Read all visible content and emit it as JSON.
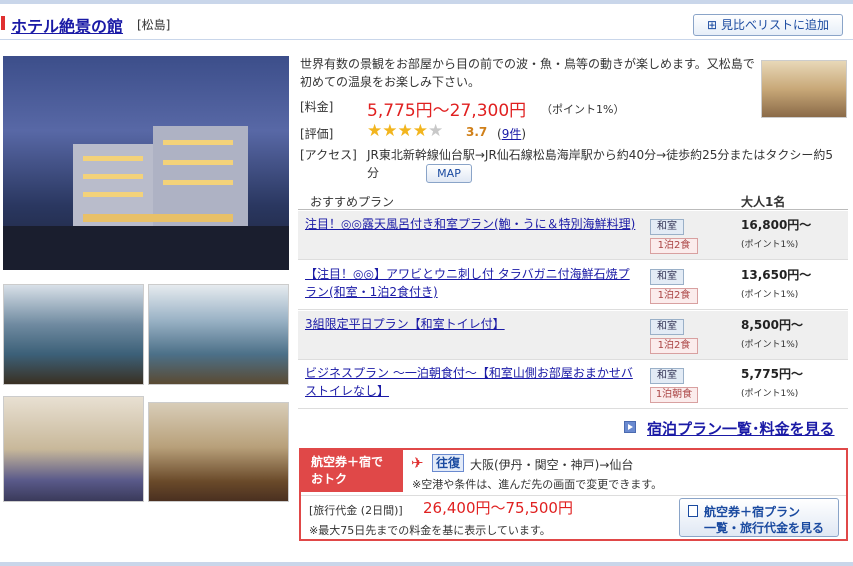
{
  "header": {
    "hotel_name": "ホテル絶景の館",
    "area": "[松島]",
    "compare_button": "見比べリストに追加"
  },
  "hotel": {
    "description": "世界有数の景観をお部屋から目の前での波・魚・鳥等の動きが楽しめます。又松島で初めての温泉をお楽しみ下さい。",
    "price_label": "[料金]",
    "price": "5,775円～27,300円",
    "price_point": "（ポイント1%）",
    "rating_label": "[評価]",
    "rating": 3.7,
    "rating_text": "3.7",
    "reviews_open": "(",
    "reviews": "9件",
    "reviews_close": ")",
    "access_label": "[アクセス]",
    "access": "JR東北新幹線仙台駅→JR仙石線松島海岸駅から約40分→徒歩約25分またはタクシー約5分",
    "map_button": "MAP"
  },
  "plans": {
    "header_plan": "おすすめプラン",
    "header_price": "大人1名",
    "items": [
      {
        "title": "注目！◎◎露天風呂付き和室プラン(鮑・うに＆特別海鮮料理)",
        "room": "和室",
        "meal": "1泊2食",
        "price": "16,800円～",
        "point": "(ポイント1%)"
      },
      {
        "title": "【注目！◎◎】アワビとウニ刺し付 タラバガニ付海鮮石焼プラン(和室・1泊2食付き)",
        "room": "和室",
        "meal": "1泊2食",
        "price": "13,650円～",
        "point": "(ポイント1%)"
      },
      {
        "title": "3組限定平日プラン【和室トイレ付】",
        "room": "和室",
        "meal": "1泊2食",
        "price": "8,500円～",
        "point": "(ポイント1%)"
      },
      {
        "title": "ビジネスプラン ～一泊朝食付～【和室山側お部屋おまかせバストイレなし】",
        "room": "和室",
        "meal": "1泊朝食",
        "price": "5,775円～",
        "point": "(ポイント1%)"
      }
    ],
    "all_plans_link": "宿泊プラン一覧･料金を見る"
  },
  "flight": {
    "tag_line1": "航空券＋宿で",
    "tag_line2": "おトク",
    "plane_icon": "airplane-icon",
    "trip_type": "往復",
    "route": "大阪(伊丹・関空・神戸)→仙台",
    "note1": "※空港や条件は、進んだ先の画面で変更できます。",
    "cost_label": "[旅行代金 (2日間)]",
    "cost": "26,400円～75,500円",
    "note2": "※最大75日先までの料金を基に表示しています。",
    "button_line1": "航空券＋宿プラン",
    "button_line2": "一覧・旅行代金を見る"
  },
  "colors": {
    "accent_red": "#e02020",
    "link_blue": "#1a1aa6",
    "star": "#f2b51e"
  }
}
